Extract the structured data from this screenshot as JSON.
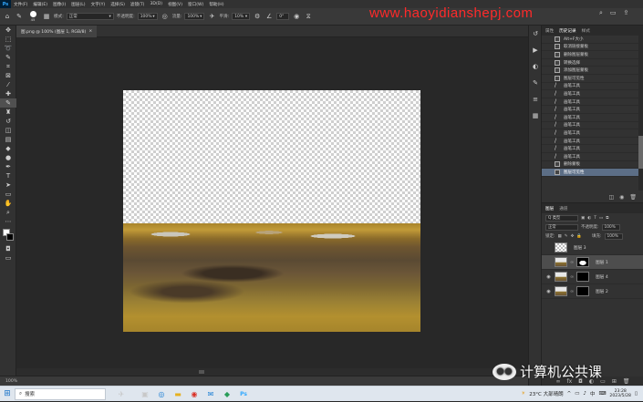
{
  "app": {
    "name": "Ps"
  },
  "menu": [
    "文件(F)",
    "编辑(E)",
    "图像(I)",
    "图层(L)",
    "文字(Y)",
    "选择(S)",
    "滤镜(T)",
    "3D(D)",
    "视图(V)",
    "窗口(W)",
    "帮助(H)"
  ],
  "options": {
    "brush_size": "45",
    "mode_label": "模式:",
    "mode_value": "正常",
    "opacity_label": "不透明度:",
    "opacity_value": "100%",
    "flow_label": "流量:",
    "flow_value": "100%",
    "smooth_label": "平滑:",
    "smooth_value": "10%",
    "angle_value": "0°"
  },
  "watermark_url": "www.haoyidianshepj.com",
  "document_tab": {
    "title": "图.png @ 100% (图层 1, RGB/8)",
    "close": "×"
  },
  "status": {
    "zoom": "100%"
  },
  "history_panel": {
    "tabs": [
      "属性",
      "历史记录",
      "样式"
    ],
    "active_tab": "历史记录",
    "items": [
      {
        "label": "Alt+F大小",
        "icon": "doc"
      },
      {
        "label": "取消链接蒙板",
        "icon": "doc"
      },
      {
        "label": "删除图层蒙板",
        "icon": "doc"
      },
      {
        "label": "转换选择",
        "icon": "doc"
      },
      {
        "label": "添加图层蒙板",
        "icon": "doc"
      },
      {
        "label": "图层可见性",
        "icon": "doc"
      },
      {
        "label": "画笔工具",
        "icon": "brush"
      },
      {
        "label": "画笔工具",
        "icon": "brush"
      },
      {
        "label": "画笔工具",
        "icon": "brush"
      },
      {
        "label": "画笔工具",
        "icon": "brush"
      },
      {
        "label": "画笔工具",
        "icon": "brush"
      },
      {
        "label": "画笔工具",
        "icon": "brush"
      },
      {
        "label": "画笔工具",
        "icon": "brush"
      },
      {
        "label": "画笔工具",
        "icon": "brush"
      },
      {
        "label": "画笔工具",
        "icon": "brush"
      },
      {
        "label": "画笔工具",
        "icon": "brush"
      },
      {
        "label": "删除蒙板",
        "icon": "doc"
      },
      {
        "label": "图层可见性",
        "icon": "doc",
        "selected": true
      }
    ]
  },
  "layers_panel": {
    "tabs": [
      "图层",
      "通道"
    ],
    "kind_label": "Q 类型",
    "blend_mode": "正常",
    "opacity_label": "不透明度:",
    "opacity_value": "100%",
    "lock_label": "锁定:",
    "fill_label": "填充:",
    "fill_value": "100%",
    "layers": [
      {
        "name": "图层 3",
        "thumb": "t-chk",
        "mask": "",
        "visible": false,
        "selected": false
      },
      {
        "name": "图层 1",
        "thumb": "t-photo",
        "mask": "t-mask",
        "visible": false,
        "selected": true
      },
      {
        "name": "图层 4",
        "thumb": "t-photo",
        "mask": "t-black",
        "visible": true,
        "selected": false
      },
      {
        "name": "图层 2",
        "thumb": "t-photo",
        "mask": "t-black",
        "visible": true,
        "selected": false
      }
    ]
  },
  "wechat_watermark": "计算机公共课",
  "taskbar": {
    "search_placeholder": "搜索",
    "weather": "23°C 大部晴朗",
    "ime": "中",
    "time": "23:28",
    "date": "2023/5/28"
  },
  "colors": {
    "accent": "#31a8ff",
    "selection": "#5c6e86",
    "watermark": "#ff2a2a"
  }
}
